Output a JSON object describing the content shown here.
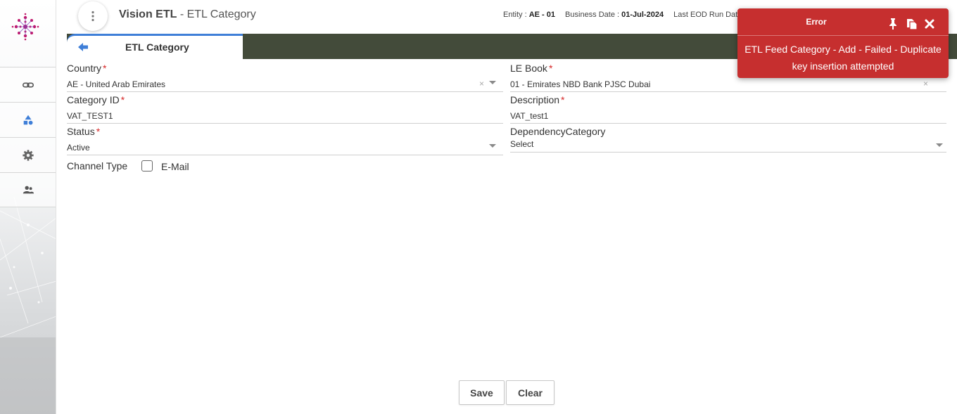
{
  "header": {
    "app_name": "Vision ETL",
    "page_name": " - ETL Category",
    "entity_label": "Entity : ",
    "entity_value": "AE - 01",
    "business_date_label": "Business Date : ",
    "business_date_value": "01-Jul-2024",
    "last_eod_label": "Last EOD Run Date"
  },
  "sidebar": {
    "items": [
      {
        "icon": "link-icon"
      },
      {
        "icon": "shapes-icon"
      },
      {
        "icon": "gear-icon"
      },
      {
        "icon": "users-icon"
      }
    ]
  },
  "tab": {
    "label": "ETL Category"
  },
  "form": {
    "country": {
      "label": "Country",
      "required": "*",
      "value": "AE - United Arab Emirates"
    },
    "le_book": {
      "label": "LE Book",
      "required": "*",
      "value": "01 - Emirates NBD Bank PJSC Dubai"
    },
    "category_id": {
      "label": "Category ID",
      "required": "*",
      "value": "VAT_TEST1"
    },
    "description": {
      "label": "Description",
      "required": "*",
      "value": "VAT_test1"
    },
    "status": {
      "label": "Status",
      "required": "*",
      "value": "Active"
    },
    "dependency_category": {
      "label": "DependencyCategory",
      "value": "Select"
    },
    "channel_type": {
      "label": "Channel Type",
      "option": "E-Mail",
      "checked": false
    }
  },
  "buttons": {
    "save": "Save",
    "clear": "Clear"
  },
  "toast": {
    "title": "Error",
    "message": "ETL Feed Category - Add - Failed - Duplicate key insertion attempted",
    "color": "#c62f2f"
  },
  "colors": {
    "tabbar": "#434b3a",
    "accent": "#3f7fd8",
    "required": "#d62828"
  }
}
